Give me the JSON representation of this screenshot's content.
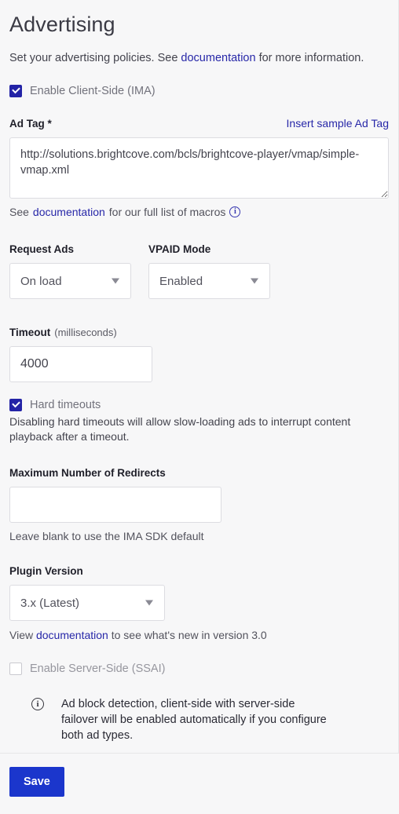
{
  "page": {
    "title": "Advertising",
    "description_before": "Set your advertising policies. See ",
    "description_link": "documentation",
    "description_after": " for more information."
  },
  "client_side": {
    "enable_label": "Enable Client-Side (IMA)",
    "enabled": true,
    "ad_tag": {
      "label": "Ad Tag *",
      "insert_sample_label": "Insert sample Ad Tag",
      "value": "http://solutions.brightcove.com/bcls/brightcove-player/vmap/simple-vmap.xml",
      "placeholder": "",
      "helper_before": "See ",
      "helper_link": "documentation",
      "helper_after": " for our full list of macros",
      "helper_info_icon": "info-icon"
    },
    "request_ads": {
      "label": "Request Ads",
      "value": "On load",
      "options": [
        "On load"
      ]
    },
    "vpaid_mode": {
      "label": "VPAID Mode",
      "value": "Enabled",
      "options": [
        "Enabled"
      ]
    },
    "timeout": {
      "label": "Timeout",
      "unit": "(milliseconds)",
      "value": "4000",
      "placeholder": ""
    },
    "hard_timeouts": {
      "label": "Hard timeouts",
      "checked": true,
      "note": "Disabling hard timeouts will allow slow-loading ads to interrupt content playback after a timeout."
    },
    "max_redirects": {
      "label": "Maximum Number of Redirects",
      "value": "",
      "placeholder": "",
      "note": "Leave blank to use the IMA SDK default"
    },
    "plugin_version": {
      "label": "Plugin Version",
      "value": "3.x (Latest)",
      "options": [
        "3.x (Latest)"
      ],
      "note_before": "View ",
      "note_link": "documentation",
      "note_after": " to see what's new in version 3.0"
    }
  },
  "server_side": {
    "enable_label": "Enable Server-Side (SSAI)",
    "enabled": false
  },
  "callout": {
    "icon": "info-icon",
    "text": "Ad block detection, client-side with server-side failover will be enabled automatically if you configure both ad types."
  },
  "footer": {
    "save_label": "Save"
  },
  "colors": {
    "accent_link": "#2727a8",
    "checkbox_checked": "#2323a6",
    "save_button": "#1b36cc",
    "page_background": "#f7f7f8"
  }
}
